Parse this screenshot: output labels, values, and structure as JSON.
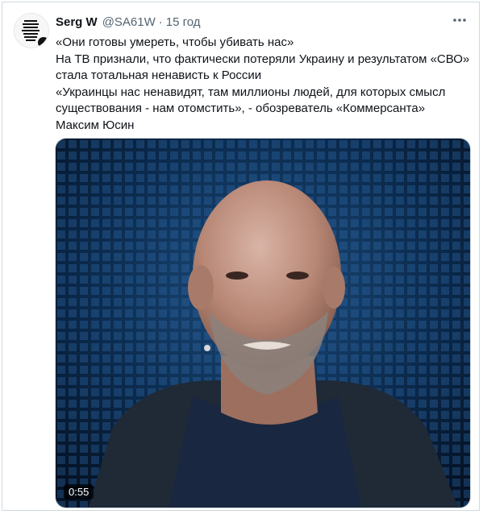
{
  "tweet": {
    "author_name": "Serg W",
    "handle": "@SA61W",
    "separator": "·",
    "time": "15 год",
    "lines": [
      "«Они готовы умереть, чтобы убивать нас»",
      "На ТВ признали, что фактически потеряли Украину и результатом «СВО»",
      "стала тотальная ненависть к России",
      "«Украинцы нас ненавидят, там миллионы людей, для которых смысл",
      "существования - нам отомстить», - обозреватель «Коммерсанта»",
      "Максим Юсин"
    ]
  },
  "video": {
    "duration": "0:55"
  },
  "icons": {
    "more": "more-horizontal-icon"
  }
}
